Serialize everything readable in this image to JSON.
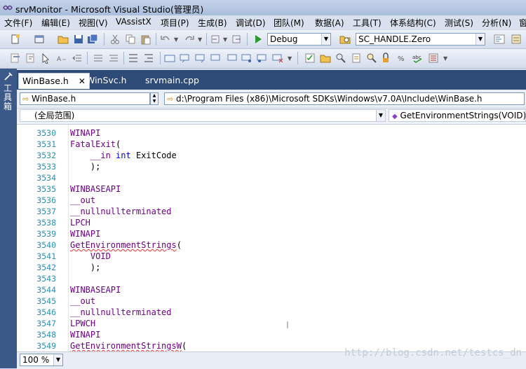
{
  "window": {
    "title": "srvMonitor - Microsoft Visual Studio(管理员)"
  },
  "menu": [
    "文件(F)",
    "编辑(E)",
    "视图(V)",
    "VAssistX",
    "项目(P)",
    "生成(B)",
    "调试(D)",
    "团队(M)",
    "数据(A)",
    "工具(T)",
    "体系结构(C)",
    "测试(S)",
    "分析(N)",
    "窗"
  ],
  "toolbar": {
    "config": "Debug",
    "find": "SC_HANDLE.Zero"
  },
  "toolbox_label": "工具箱",
  "tabs": [
    {
      "label": "WinBase.h",
      "active": true
    },
    {
      "label": "WinSvc.h",
      "active": false
    },
    {
      "label": "srvmain.cpp",
      "active": false
    }
  ],
  "nav": {
    "file": "WinBase.h",
    "path": "d:\\Program Files (x86)\\Microsoft SDKs\\Windows\\v7.0A\\Include\\WinBase.h",
    "scope": "(全局范围)",
    "member": "GetEnvironmentStrings(VOID)"
  },
  "code_lines": [
    {
      "n": "3530",
      "parts": [
        {
          "t": "WINAPI",
          "c": "macro"
        }
      ]
    },
    {
      "n": "3531",
      "parts": [
        {
          "t": "FatalExit",
          "c": "macro"
        },
        {
          "t": "(",
          "c": "plain"
        }
      ]
    },
    {
      "n": "3532",
      "parts": [
        {
          "t": "    __in ",
          "c": "macro"
        },
        {
          "t": "int",
          "c": "kw"
        },
        {
          "t": " ExitCode",
          "c": "plain"
        }
      ]
    },
    {
      "n": "3533",
      "parts": [
        {
          "t": "    );",
          "c": "plain"
        }
      ]
    },
    {
      "n": "3534",
      "parts": []
    },
    {
      "n": "3535",
      "parts": [
        {
          "t": "WINBASEAPI",
          "c": "macro"
        }
      ]
    },
    {
      "n": "3536",
      "parts": [
        {
          "t": "__out",
          "c": "macro"
        }
      ]
    },
    {
      "n": "3537",
      "parts": [
        {
          "t": "__nullnullterminated",
          "c": "macro"
        }
      ]
    },
    {
      "n": "3538",
      "parts": [
        {
          "t": "LPCH",
          "c": "macro"
        }
      ]
    },
    {
      "n": "3539",
      "parts": [
        {
          "t": "WINAPI",
          "c": "macro"
        }
      ]
    },
    {
      "n": "3540",
      "parts": [
        {
          "t": "GetEnvironmentStrings",
          "c": "macro-sq"
        },
        {
          "t": "(",
          "c": "plain"
        }
      ]
    },
    {
      "n": "3541",
      "parts": [
        {
          "t": "    VOID",
          "c": "macro"
        }
      ]
    },
    {
      "n": "3542",
      "parts": [
        {
          "t": "    );",
          "c": "plain"
        }
      ]
    },
    {
      "n": "3543",
      "parts": []
    },
    {
      "n": "3544",
      "parts": [
        {
          "t": "WINBASEAPI",
          "c": "macro"
        }
      ]
    },
    {
      "n": "3545",
      "parts": [
        {
          "t": "__out",
          "c": "macro"
        }
      ]
    },
    {
      "n": "3546",
      "parts": [
        {
          "t": "__nullnullterminated",
          "c": "macro"
        }
      ]
    },
    {
      "n": "3547",
      "parts": [
        {
          "t": "LPWCH",
          "c": "macro"
        }
      ]
    },
    {
      "n": "3548",
      "parts": [
        {
          "t": "WINAPI",
          "c": "macro"
        }
      ]
    },
    {
      "n": "3549",
      "parts": [
        {
          "t": "GetEnvironmentStringsW",
          "c": "macro-sq"
        },
        {
          "t": "(",
          "c": "plain"
        }
      ]
    }
  ],
  "status": {
    "zoom": "100 %"
  },
  "watermark": "http://blog.csdn.net/testcs_dn",
  "colors": {
    "macro": "#6f008a",
    "keyword": "#0000ff",
    "line_number": "#2b91af",
    "tab_strip": "#2e4a77"
  }
}
